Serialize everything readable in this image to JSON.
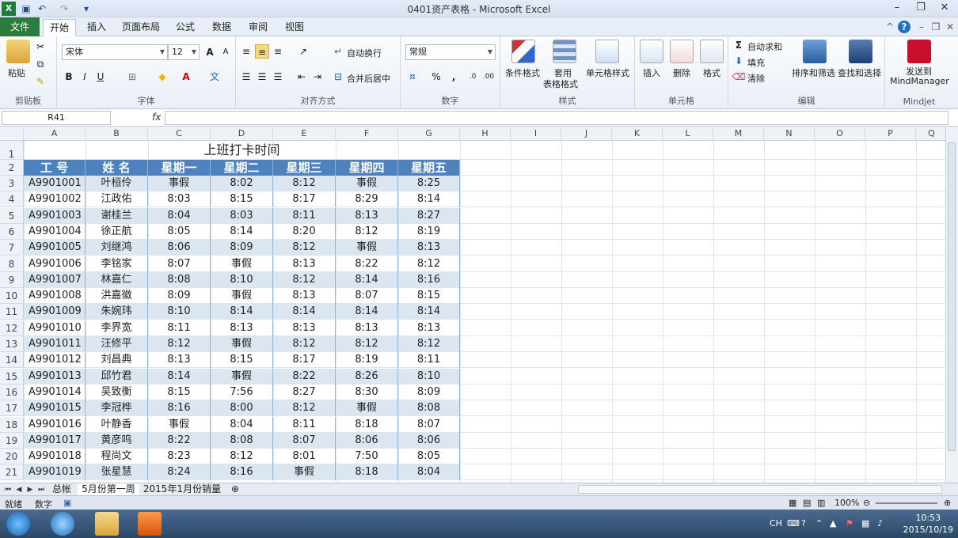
{
  "app": {
    "title": "0401资产表格 - Microsoft Excel"
  },
  "tabs": [
    {
      "label": "文件"
    },
    {
      "label": "开始"
    },
    {
      "label": "插入"
    },
    {
      "label": "页面布局"
    },
    {
      "label": "公式"
    },
    {
      "label": "数据"
    },
    {
      "label": "审阅"
    },
    {
      "label": "视图"
    }
  ],
  "ribbon": {
    "clipboard": {
      "label": "剪贴板",
      "paste": "粘贴"
    },
    "font": {
      "label": "字体",
      "name": "宋体",
      "size": "12",
      "bold": "B",
      "italic": "I",
      "underline": "U"
    },
    "align": {
      "label": "对齐方式",
      "wrap": "自动换行",
      "merge": "合并后居中"
    },
    "number": {
      "label": "数字",
      "format": "常规",
      "percent": "%",
      "comma": ","
    },
    "styles": {
      "label": "样式",
      "conditional": "条件格式",
      "table_line1": "套用",
      "table_line2": "表格格式",
      "cell": "单元格样式"
    },
    "cells": {
      "label": "单元格",
      "insert": "插入",
      "delete": "删除",
      "format": "格式"
    },
    "editing": {
      "label": "编辑",
      "autosum": "自动求和",
      "fill": "填充",
      "clear": "清除",
      "sort": "排序和筛选",
      "find": "查找和选择"
    },
    "mindjet": {
      "label": "Mindjet",
      "send_line1": "发送到",
      "send_line2": "MindManager"
    }
  },
  "formula_bar": {
    "name_box": "R41",
    "fx": "fx",
    "content": ""
  },
  "columns": [
    "A",
    "B",
    "C",
    "D",
    "E",
    "F",
    "G",
    "H",
    "I",
    "J",
    "K",
    "L",
    "M",
    "N",
    "O",
    "P",
    "Q"
  ],
  "sheet": {
    "title": "上班打卡时间",
    "headers": [
      "工 号",
      "姓 名",
      "星期一",
      "星期二",
      "星期三",
      "星期四",
      "星期五"
    ],
    "rows": [
      [
        "A9901001",
        "叶桓伶",
        "事假",
        "8:02",
        "8:12",
        "事假",
        "8:25"
      ],
      [
        "A9901002",
        "江政佑",
        "8:03",
        "8:15",
        "8:17",
        "8:29",
        "8:14"
      ],
      [
        "A9901003",
        "谢桂兰",
        "8:04",
        "8:03",
        "8:11",
        "8:13",
        "8:27"
      ],
      [
        "A9901004",
        "徐正航",
        "8:05",
        "8:14",
        "8:20",
        "8:12",
        "8:19"
      ],
      [
        "A9901005",
        "刘继鸿",
        "8:06",
        "8:09",
        "8:12",
        "事假",
        "8:13"
      ],
      [
        "A9901006",
        "李铭家",
        "8:07",
        "事假",
        "8:13",
        "8:22",
        "8:12"
      ],
      [
        "A9901007",
        "林嘉仁",
        "8:08",
        "8:10",
        "8:12",
        "8:14",
        "8:16"
      ],
      [
        "A9901008",
        "洪嘉徽",
        "8:09",
        "事假",
        "8:13",
        "8:07",
        "8:15"
      ],
      [
        "A9901009",
        "朱婉玮",
        "8:10",
        "8:14",
        "8:14",
        "8:14",
        "8:14"
      ],
      [
        "A9901010",
        "李界宽",
        "8:11",
        "8:13",
        "8:13",
        "8:13",
        "8:13"
      ],
      [
        "A9901011",
        "汪修平",
        "8:12",
        "事假",
        "8:12",
        "8:12",
        "8:12"
      ],
      [
        "A9901012",
        "刘昌典",
        "8:13",
        "8:15",
        "8:17",
        "8:19",
        "8:11"
      ],
      [
        "A9901013",
        "邱竹君",
        "8:14",
        "事假",
        "8:22",
        "8:26",
        "8:10"
      ],
      [
        "A9901014",
        "吴致衡",
        "8:15",
        "7:56",
        "8:27",
        "8:30",
        "8:09"
      ],
      [
        "A9901015",
        "李冠桦",
        "8:16",
        "8:00",
        "8:12",
        "事假",
        "8:08"
      ],
      [
        "A9901016",
        "叶静香",
        "事假",
        "8:04",
        "8:11",
        "8:18",
        "8:07"
      ],
      [
        "A9901017",
        "黄彦鸣",
        "8:22",
        "8:08",
        "8:07",
        "8:06",
        "8:06"
      ],
      [
        "A9901018",
        "程尚文",
        "8:23",
        "8:12",
        "8:01",
        "7:50",
        "8:05"
      ],
      [
        "A9901019",
        "张星慧",
        "8:24",
        "8:16",
        "事假",
        "8:18",
        "8:04"
      ]
    ],
    "row_numbers": [
      "1",
      "2",
      "3",
      "4",
      "5",
      "6",
      "7",
      "8",
      "9",
      "10",
      "11",
      "12",
      "13",
      "14",
      "15",
      "16",
      "17",
      "18",
      "19",
      "20",
      "21"
    ]
  },
  "sheet_tabs": [
    {
      "label": "总帐"
    },
    {
      "label": "5月份第一周"
    },
    {
      "label": "2015年1月份销量"
    }
  ],
  "status": {
    "ready": "就绪",
    "mode": "数字",
    "zoom": "100%"
  },
  "taskbar": {
    "lang": "CH",
    "time": "10:53",
    "date": "2015/10/19"
  },
  "colors": {
    "header": "#4f81bd",
    "band": "#dce6f1",
    "file_tab": "#2a7d3b"
  }
}
